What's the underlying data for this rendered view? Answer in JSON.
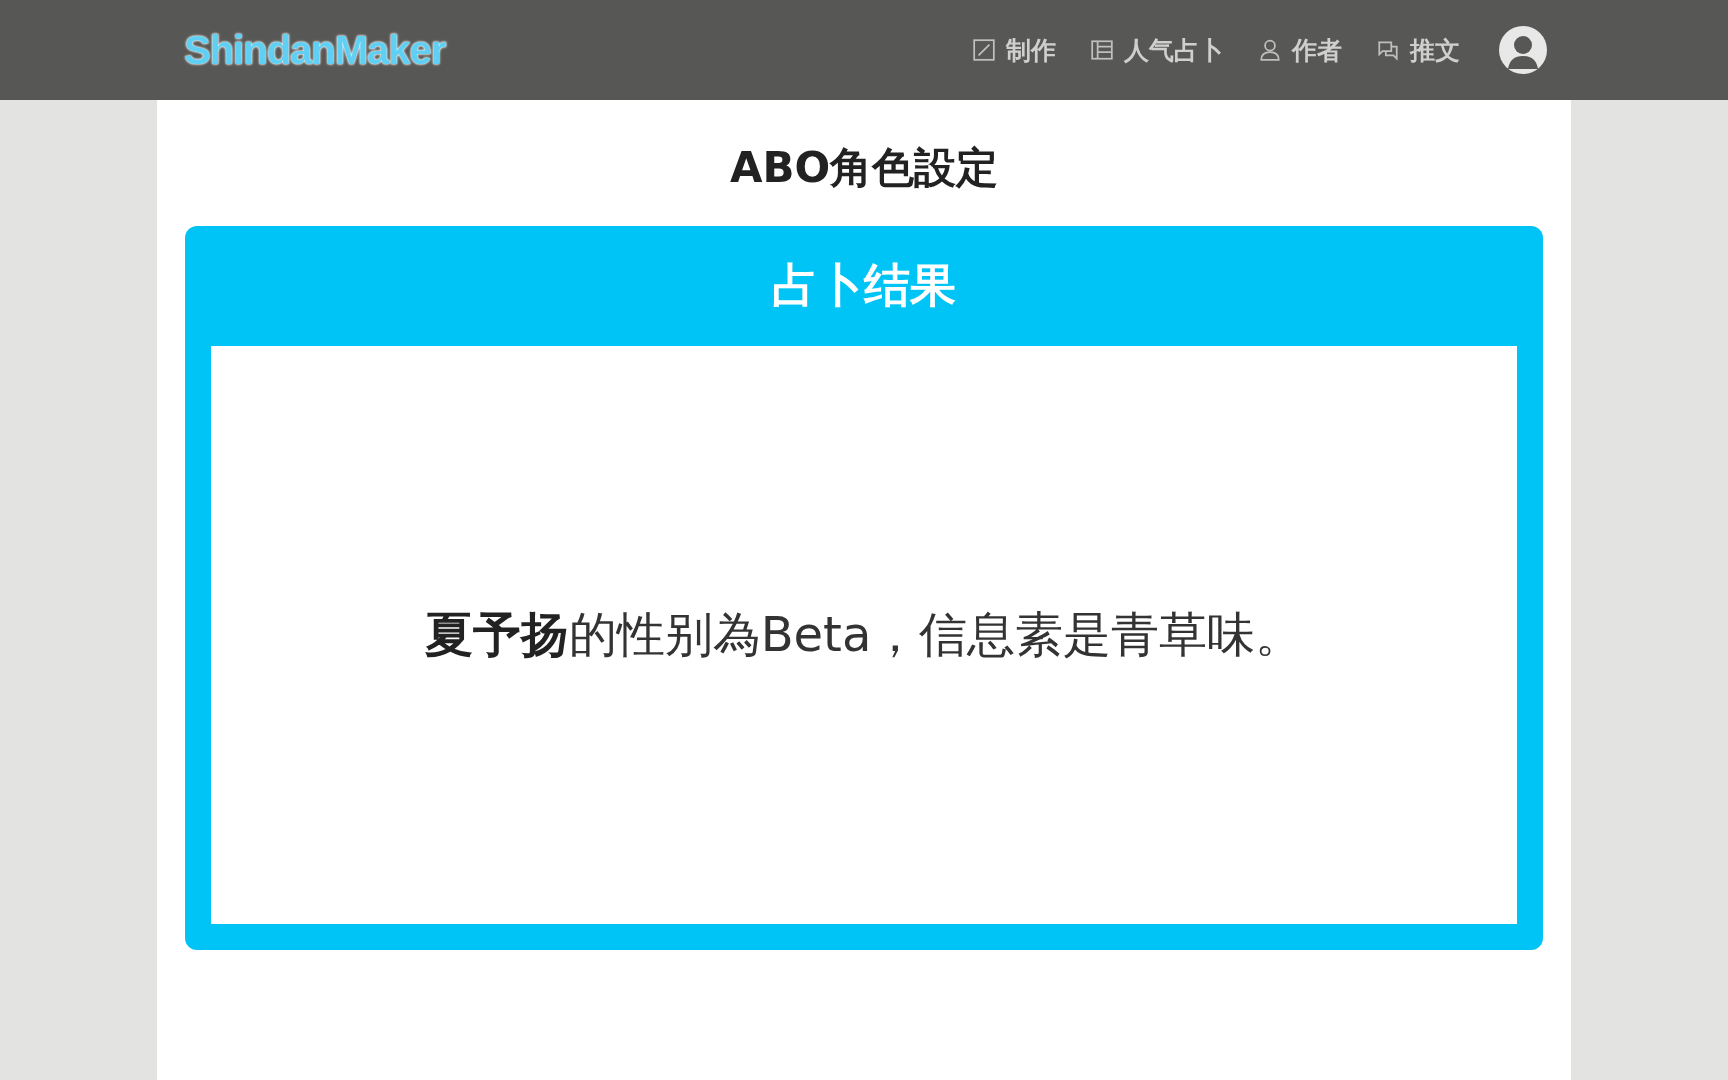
{
  "header": {
    "logo": "ShindanMaker",
    "nav": [
      {
        "kind": "edit",
        "label": "制作"
      },
      {
        "kind": "list",
        "label": "人气占卜"
      },
      {
        "kind": "person",
        "label": "作者"
      },
      {
        "kind": "chat",
        "label": "推文"
      }
    ]
  },
  "title": "ABO角色設定",
  "result": {
    "heading": "占卜结果",
    "text": "**夏予扬**的性别為Beta，信息素是青草味。"
  }
}
